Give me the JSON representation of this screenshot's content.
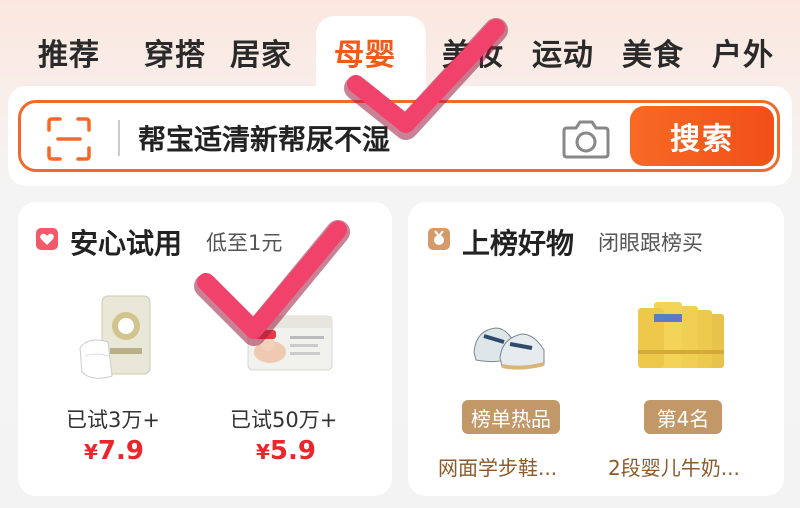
{
  "tabs": [
    {
      "label": "推荐"
    },
    {
      "label": "穿搭"
    },
    {
      "label": "居家"
    },
    {
      "label": "母婴",
      "active": true
    },
    {
      "label": "美妆"
    },
    {
      "label": "运动"
    },
    {
      "label": "美食"
    },
    {
      "label": "户外"
    }
  ],
  "search": {
    "query": "帮宝适清新帮尿不湿",
    "button_label": "搜索",
    "scan_icon": "scan-icon",
    "camera_icon": "camera-icon"
  },
  "trial_card": {
    "icon": "heart-icon",
    "title": "安心试用",
    "subtitle": "低至1元",
    "items": [
      {
        "tried": "已试3万+",
        "currency": "¥",
        "price": "7.9"
      },
      {
        "tried": "已试50万+",
        "currency": "¥",
        "price": "5.9"
      }
    ]
  },
  "ranking_card": {
    "icon": "medal-icon",
    "title": "上榜好物",
    "subtitle": "闭眼跟榜买",
    "items": [
      {
        "badge": "榜单热品",
        "name": "网面学步鞋..."
      },
      {
        "badge": "第4名",
        "name": "2段婴儿牛奶..."
      }
    ]
  },
  "colors": {
    "accent": "#f05a1a",
    "price": "#e8262b",
    "badge": "#c29868",
    "checkmark": "#f0426a"
  }
}
